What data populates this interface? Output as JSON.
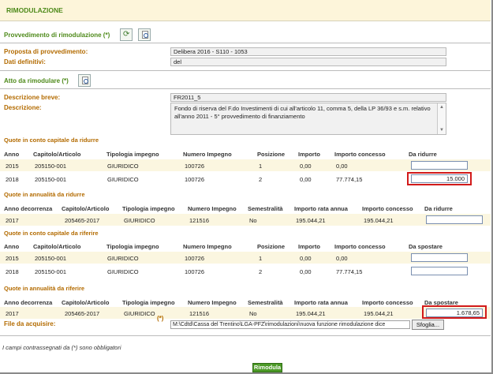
{
  "page_title": "RIMODULAZIONE",
  "provv": {
    "heading": "Provvedimento di rimodulazione (*)",
    "proposta_label": "Proposta di provvedimento:",
    "proposta_value": "Delibera 2016 - S110 - 1053",
    "dati_label": "Dati definitivi:",
    "dati_value": "del"
  },
  "atto": {
    "heading": "Atto da rimodulare (*)",
    "desc_breve_label": "Descrizione breve:",
    "desc_breve_value": "FR2011_5",
    "desc_label": "Descrizione:",
    "desc_value": "Fondo di riserva del F.do Investimenti di cui all'articolo 11, comma 5, della LP 36/93 e s.m. relativo all'anno 2011 - 5° provvedimento di finanziamento"
  },
  "capitale_ridurre": {
    "title": "Quote in conto capitale da ridurre",
    "headers": [
      "Anno",
      "Capitolo/Articolo",
      "Tipologia impegno",
      "Numero Impegno",
      "Posizione",
      "Importo",
      "Importo concesso",
      "Da ridurre"
    ],
    "rows": [
      {
        "anno": "2015",
        "capitolo": "205150-001",
        "tipologia": "GIURIDICO",
        "numero": "100726",
        "posizione": "1",
        "importo": "0,00",
        "concesso": "0,00",
        "input": ""
      },
      {
        "anno": "2018",
        "capitolo": "205150-001",
        "tipologia": "GIURIDICO",
        "numero": "100726",
        "posizione": "2",
        "importo": "0,00",
        "concesso": "77.774,15",
        "input": "15.000"
      }
    ]
  },
  "annualita_ridurre": {
    "title": "Quote in annualità da ridurre",
    "headers": [
      "Anno decorrenza",
      "Capitolo/Articolo",
      "Tipologia impegno",
      "Numero Impegno",
      "Semestralità",
      "Importo rata annua",
      "Importo concesso",
      "Da ridurre"
    ],
    "rows": [
      {
        "anno": "2017",
        "capitolo": "205465-2017",
        "tipologia": "GIURIDICO",
        "numero": "121516",
        "sem": "No",
        "rata": "195.044,21",
        "concesso": "195.044,21",
        "input": ""
      }
    ]
  },
  "capitale_riferire": {
    "title": "Quote in conto capitale da riferire",
    "headers": [
      "Anno",
      "Capitolo/Articolo",
      "Tipologia impegno",
      "Numero Impegno",
      "Posizione",
      "Importo",
      "Importo concesso",
      "Da spostare"
    ],
    "rows": [
      {
        "anno": "2015",
        "capitolo": "205150-001",
        "tipologia": "GIURIDICO",
        "numero": "100726",
        "posizione": "1",
        "importo": "0,00",
        "concesso": "0,00",
        "input": ""
      },
      {
        "anno": "2018",
        "capitolo": "205150-001",
        "tipologia": "GIURIDICO",
        "numero": "100726",
        "posizione": "2",
        "importo": "0,00",
        "concesso": "77.774,15",
        "input": ""
      }
    ]
  },
  "annualita_riferire": {
    "title": "Quote in annualità da riferire",
    "headers": [
      "Anno decorrenza",
      "Capitolo/Articolo",
      "Tipologia impegno",
      "Numero Impegno",
      "Semestralità",
      "Importo rata annua",
      "Importo concesso",
      "Da spostare"
    ],
    "rows": [
      {
        "anno": "2017",
        "capitolo": "205465-2017",
        "tipologia": "GIURIDICO",
        "numero": "121516",
        "sem": "No",
        "rata": "195.044,21",
        "concesso": "195.044,21",
        "input": "1.678,65"
      }
    ]
  },
  "file": {
    "label": "File da acquisire:",
    "required_mark": "(*)",
    "value": "M:\\Cdtd\\Cassa del Trentino\\LGA-PFZ\\rimodulazioni\\nuova funzione rimodulazione dice",
    "browse_label": "Sfoglia..."
  },
  "note": "I campi contrassegnati da (*) sono obbligatori",
  "submit_label": "Rimodula",
  "colors": {
    "accent_green": "#4e8a1a",
    "label_orange": "#b36b00",
    "highlight_red": "#d21a1a",
    "row_alt": "#fbf6e0"
  }
}
